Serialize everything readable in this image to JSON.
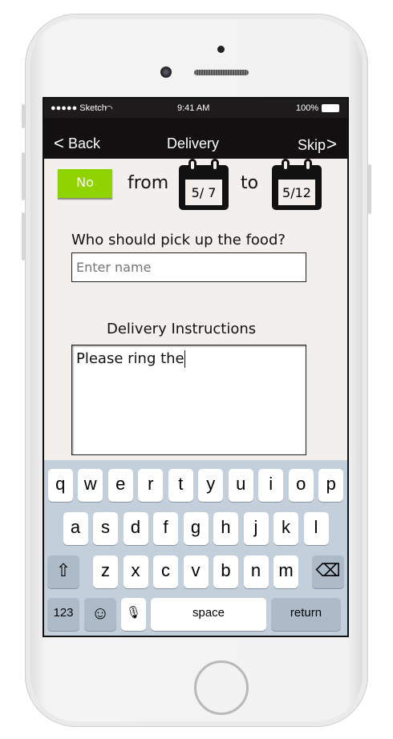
{
  "status": {
    "carrier": "●●●●● Sketch",
    "time": "9:41 AM",
    "battery": "100%"
  },
  "nav": {
    "back": "Back",
    "title": "Delivery",
    "skip": "Skip"
  },
  "form": {
    "toggle": "No",
    "from": "from",
    "to": "to",
    "from_date": "5/ 7",
    "to_date": "5/12",
    "pickup_question": "Who should pick up the food?",
    "name_placeholder": "Enter name",
    "instructions_label": "Delivery Instructions",
    "instructions_value": "Please ring the"
  },
  "keyboard": {
    "row1": [
      "q",
      "w",
      "e",
      "r",
      "t",
      "y",
      "u",
      "i",
      "o",
      "p"
    ],
    "row2": [
      "a",
      "s",
      "d",
      "f",
      "g",
      "h",
      "j",
      "k",
      "l"
    ],
    "row3": [
      "z",
      "x",
      "c",
      "v",
      "b",
      "n",
      "m"
    ],
    "numbers": "123",
    "space": "space",
    "return": "return",
    "shift": "⇧",
    "delete": "⌫",
    "emoji": "☺",
    "mic": "🎙"
  },
  "colors": {
    "accent": "#8fd400",
    "bar": "#121010",
    "keyboard": "#c3d0dc"
  }
}
